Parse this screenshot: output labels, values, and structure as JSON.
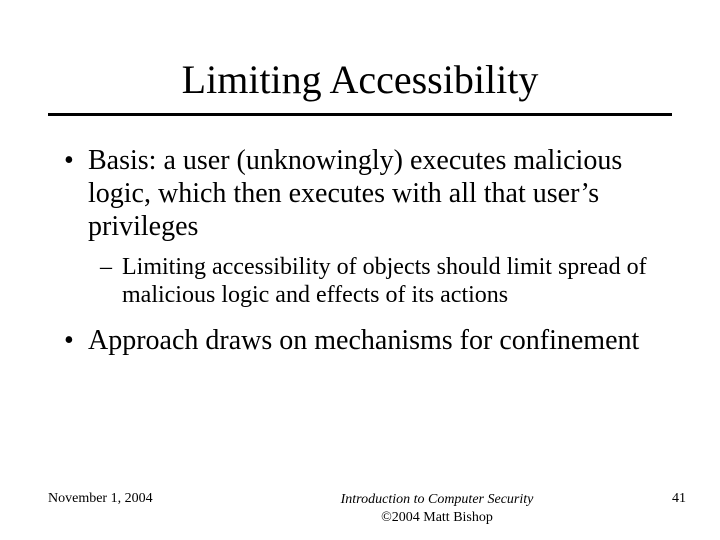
{
  "title": "Limiting Accessibility",
  "bullets": {
    "b1": "Basis: a user (unknowingly) executes malicious logic, which then executes with all that user’s privileges",
    "b1_sub": "Limiting accessibility of objects should limit spread of malicious logic and effects of its actions",
    "b2": "Approach draws on mechanisms for confinement"
  },
  "footer": {
    "date": "November 1, 2004",
    "center_title": "Introduction to Computer Security",
    "center_copy": "©2004 Matt Bishop",
    "page": "41"
  }
}
